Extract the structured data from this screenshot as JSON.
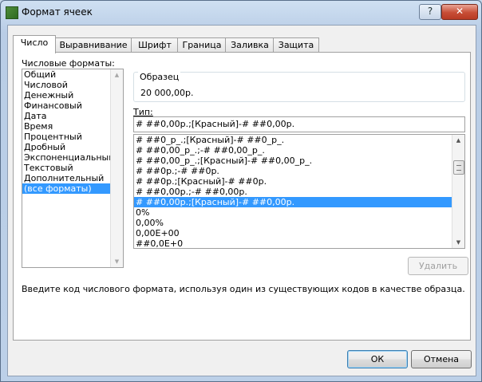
{
  "window": {
    "title": "Формат ячеек",
    "help_label": "?",
    "close_label": "✕"
  },
  "tabs": [
    {
      "label": "Число",
      "active": true
    },
    {
      "label": "Выравнивание",
      "active": false
    },
    {
      "label": "Шрифт",
      "active": false
    },
    {
      "label": "Граница",
      "active": false
    },
    {
      "label": "Заливка",
      "active": false
    },
    {
      "label": "Защита",
      "active": false
    }
  ],
  "categories": {
    "label": "Числовые форматы:",
    "items": [
      {
        "label": "Общий",
        "selected": false
      },
      {
        "label": "Числовой",
        "selected": false
      },
      {
        "label": "Денежный",
        "selected": false
      },
      {
        "label": "Финансовый",
        "selected": false
      },
      {
        "label": "Дата",
        "selected": false
      },
      {
        "label": "Время",
        "selected": false
      },
      {
        "label": "Процентный",
        "selected": false
      },
      {
        "label": "Дробный",
        "selected": false
      },
      {
        "label": "Экспоненциальный",
        "selected": false
      },
      {
        "label": "Текстовый",
        "selected": false
      },
      {
        "label": "Дополнительный",
        "selected": false
      },
      {
        "label": "(все форматы)",
        "selected": true
      }
    ]
  },
  "sample": {
    "label": "Образец",
    "value": "20 000,00р."
  },
  "type": {
    "label": "Тип:",
    "value": "# ##0,00р.;[Красный]-# ##0,00р.",
    "formats": [
      {
        "label": "# ##0_р_.;[Красный]-# ##0_р_.",
        "selected": false
      },
      {
        "label": "# ##0,00_р_.;-# ##0,00_р_.",
        "selected": false
      },
      {
        "label": "# ##0,00_р_.;[Красный]-# ##0,00_р_.",
        "selected": false
      },
      {
        "label": "# ##0р.;-# ##0р.",
        "selected": false
      },
      {
        "label": "# ##0р.;[Красный]-# ##0р.",
        "selected": false
      },
      {
        "label": "# ##0,00р.;-# ##0,00р.",
        "selected": false
      },
      {
        "label": "# ##0,00р.;[Красный]-# ##0,00р.",
        "selected": true
      },
      {
        "label": "0%",
        "selected": false
      },
      {
        "label": "0,00%",
        "selected": false
      },
      {
        "label": "0,00E+00",
        "selected": false
      },
      {
        "label": "##0,0E+0",
        "selected": false
      }
    ]
  },
  "delete_button": "Удалить",
  "hint": "Введите код числового формата, используя один из существующих кодов в качестве образца.",
  "ok_button": "ОК",
  "cancel_button": "Отмена"
}
